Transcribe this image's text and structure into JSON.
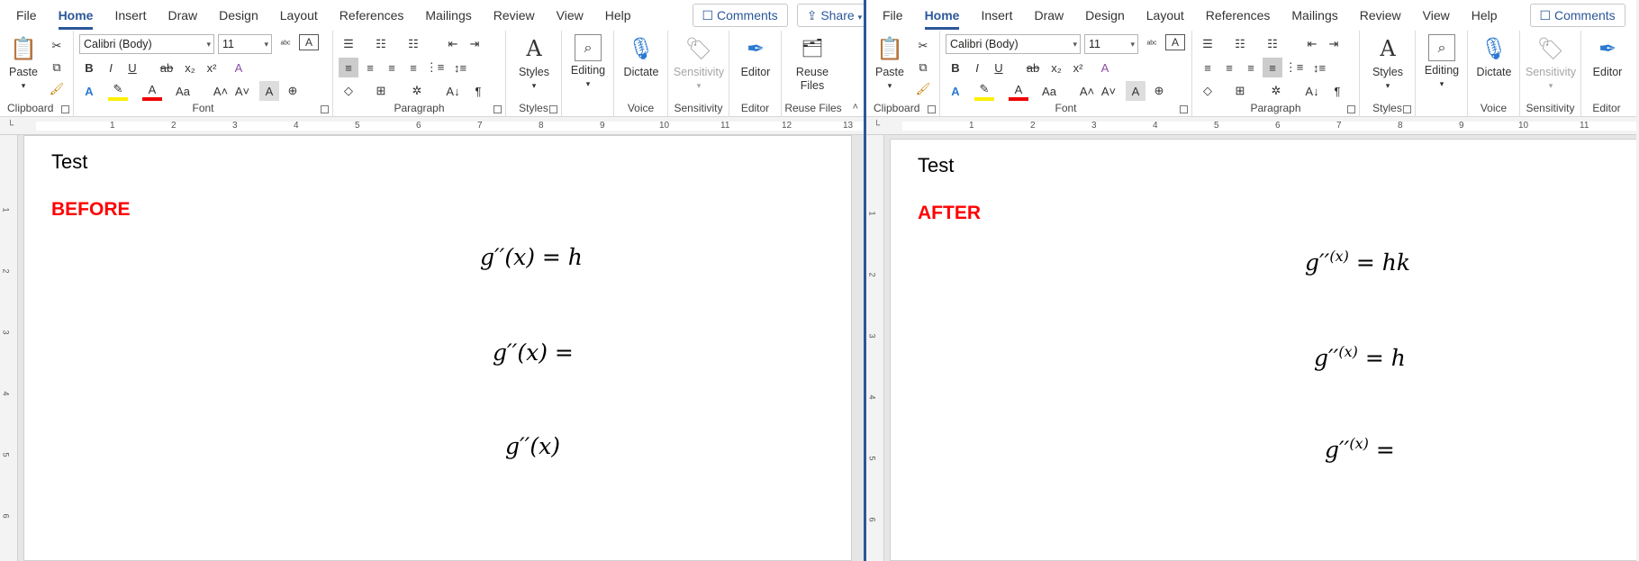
{
  "left": {
    "tabs": [
      "File",
      "Home",
      "Insert",
      "Draw",
      "Design",
      "Layout",
      "References",
      "Mailings",
      "Review",
      "View",
      "Help"
    ],
    "comments_label": "Comments",
    "share_label": "Share",
    "ribbon": {
      "paste": "Paste",
      "clipboard": "Clipboard",
      "font_name": "Calibri (Body)",
      "font_size": "11",
      "font": "Font",
      "paragraph": "Paragraph",
      "styles_btn": "Styles",
      "styles": "Styles",
      "editing": "Editing",
      "dictate": "Dictate",
      "voice": "Voice",
      "sensitivity_btn": "Sensitivity",
      "sensitivity": "Sensitivity",
      "editor_btn": "Editor",
      "editor": "Editor",
      "reuse_files_btn": "Reuse Files",
      "reuse_files": "Reuse Files"
    },
    "ruler_numbers": [
      "1",
      "2",
      "3",
      "4",
      "5",
      "6",
      "7",
      "8",
      "9",
      "10",
      "11",
      "12",
      "13"
    ],
    "vruler_numbers": [
      "1",
      "2",
      "3",
      "4",
      "5",
      "6"
    ],
    "doc": {
      "title": "Test",
      "label": "BEFORE",
      "eq1_a": "g′′(x) = h",
      "eq2_a": "g′′(x) =",
      "eq3_a": "g′′(x)"
    }
  },
  "right": {
    "tabs": [
      "File",
      "Home",
      "Insert",
      "Draw",
      "Design",
      "Layout",
      "References",
      "Mailings",
      "Review",
      "View",
      "Help"
    ],
    "comments_label": "Comments",
    "ribbon": {
      "paste": "Paste",
      "clipboard": "Clipboard",
      "font_name": "Calibri (Body)",
      "font_size": "11",
      "font": "Font",
      "paragraph": "Paragraph",
      "styles_btn": "Styles",
      "styles": "Styles",
      "editing": "Editing",
      "dictate": "Dictate",
      "voice": "Voice",
      "sensitivity_btn": "Sensitivity",
      "sensitivity": "Sensitivity",
      "editor_btn": "Editor",
      "editor": "Editor"
    },
    "ruler_numbers": [
      "1",
      "2",
      "3",
      "4",
      "5",
      "6",
      "7",
      "8",
      "9",
      "10",
      "11"
    ],
    "vruler_numbers": [
      "1",
      "2",
      "3",
      "4",
      "5",
      "6"
    ],
    "doc": {
      "title": "Test",
      "label": "AFTER",
      "eq1_base": "g′′",
      "eq1_sup": "(x)",
      "eq1_rest": " = hk",
      "eq2_base": "g′′",
      "eq2_sup": "(x)",
      "eq2_rest": " = h",
      "eq3_base": "g′′",
      "eq3_sup": "(x)",
      "eq3_rest": " ="
    }
  }
}
